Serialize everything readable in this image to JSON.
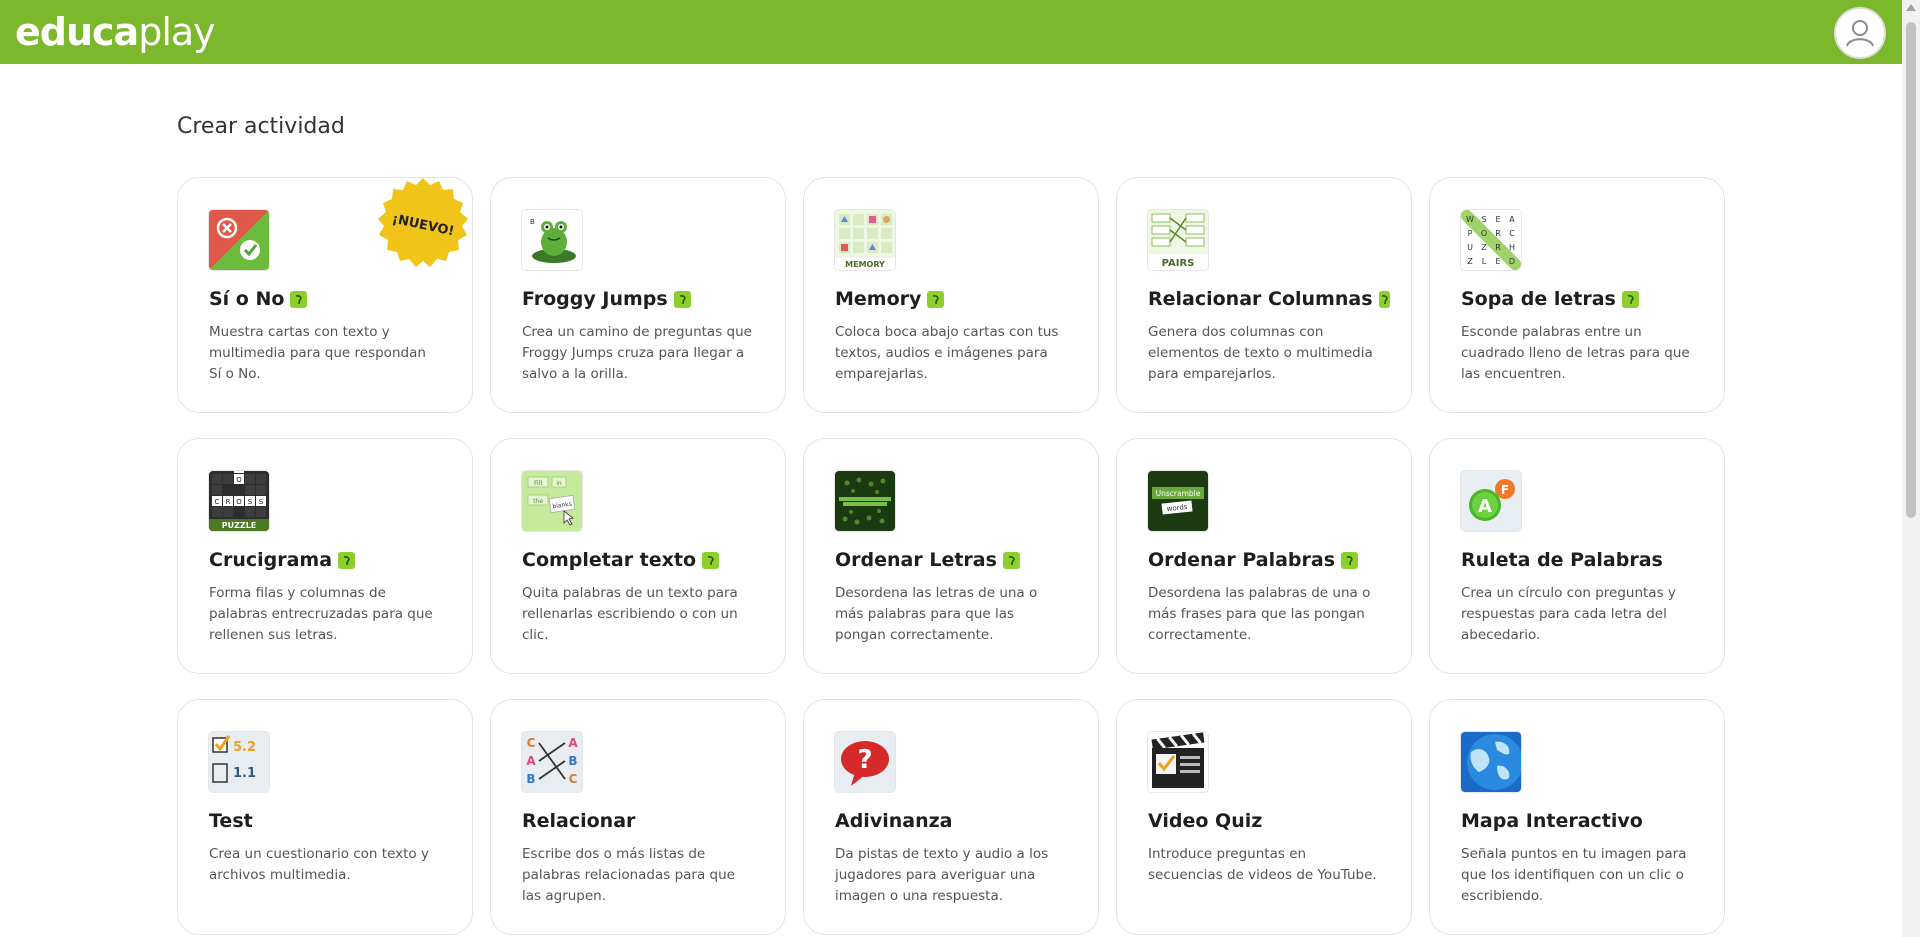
{
  "brand": {
    "logo_bold": "educa",
    "logo_light": "play",
    "accent": "#7bb82b"
  },
  "header": {
    "avatar_icon": "user-icon"
  },
  "page": {
    "title": "Crear actividad"
  },
  "badges": {
    "nuevo": "¡NUEVO!"
  },
  "cards": [
    {
      "title": "Sí o No",
      "desc": "Muestra cartas con texto y multimedia para que respondan Sí o No.",
      "icon": "yes-no-icon"
    },
    {
      "title": "Froggy Jumps",
      "desc": "Crea un camino de preguntas que Froggy Jumps cruza para llegar a salvo a la orilla.",
      "icon": "frog-icon"
    },
    {
      "title": "Memory",
      "desc": "Coloca boca abajo cartas con tus textos, audios e imágenes para emparejarlas.",
      "icon": "memory-icon"
    },
    {
      "title": "Relacionar Columnas",
      "desc": "Genera dos columnas con elementos de texto o multimedia para emparejarlos.",
      "icon": "pairs-icon"
    },
    {
      "title": "Sopa de letras",
      "desc": "Esconde palabras entre un cuadrado lleno de letras para que las encuentren.",
      "icon": "word-search-icon"
    },
    {
      "title": "Crucigrama",
      "desc": "Forma filas y columnas de palabras entrecruzadas para que rellenen sus letras.",
      "icon": "crossword-icon"
    },
    {
      "title": "Completar texto",
      "desc": "Quita palabras de un texto para rellenarlas escribiendo o con un clic.",
      "icon": "fill-blanks-icon"
    },
    {
      "title": "Ordenar Letras",
      "desc": "Desordena las letras de una o más palabras para que las pongan correctamente.",
      "icon": "unscramble-letters-icon"
    },
    {
      "title": "Ordenar Palabras",
      "desc": "Desordena las palabras de una o más frases para que las pongan correctamente.",
      "icon": "unscramble-words-icon"
    },
    {
      "title": "Ruleta de Palabras",
      "desc": "Crea un círculo con preguntas y respuestas para cada letra del abecedario.",
      "icon": "word-wheel-icon"
    },
    {
      "title": "Test",
      "desc": "Crea un cuestionario con texto y archivos multimedia.",
      "icon": "test-icon"
    },
    {
      "title": "Relacionar",
      "desc": "Escribe dos o más listas de palabras relacionadas para que las agrupen.",
      "icon": "relate-icon"
    },
    {
      "title": "Adivinanza",
      "desc": "Da pistas de texto y audio a los jugadores para averiguar una imagen o una respuesta.",
      "icon": "riddle-icon"
    },
    {
      "title": "Video Quiz",
      "desc": "Introduce preguntas en secuencias de videos de YouTube.",
      "icon": "video-quiz-icon"
    },
    {
      "title": "Mapa Interactivo",
      "desc": "Señala puntos en tu imagen para que los identifiquen con un clic o escribiendo.",
      "icon": "map-icon"
    }
  ],
  "icon_text": {
    "memory": "MEMORY",
    "pairs": "PAIRS",
    "word_search": [
      "W",
      "S",
      "E",
      "A",
      "P",
      "O",
      "R",
      "C",
      "U",
      "Z",
      "R",
      "H",
      "Z",
      "L",
      "E",
      "D"
    ],
    "crossword_word": [
      "W",
      "O",
      "R",
      "D"
    ],
    "crossword_cross": [
      "C",
      "R",
      "O",
      "S",
      "S"
    ],
    "crossword_puzzle": "PUZZLE",
    "fill_words": [
      "Fill",
      "in",
      "the",
      "blanks"
    ],
    "unscramble_top": "Unscramble",
    "unscramble_bottom": "words",
    "wheel_letters": [
      "A",
      "F"
    ],
    "test_numbers": [
      "5.2",
      "1.1"
    ],
    "relate_left": [
      "C",
      "A",
      "B"
    ],
    "relate_right": [
      "A",
      "B",
      "C"
    ],
    "riddle_mark": "?"
  },
  "sound_badges": [
    true,
    true,
    true,
    true,
    true,
    true,
    true,
    true,
    true,
    false,
    false,
    false,
    false,
    false,
    false
  ]
}
